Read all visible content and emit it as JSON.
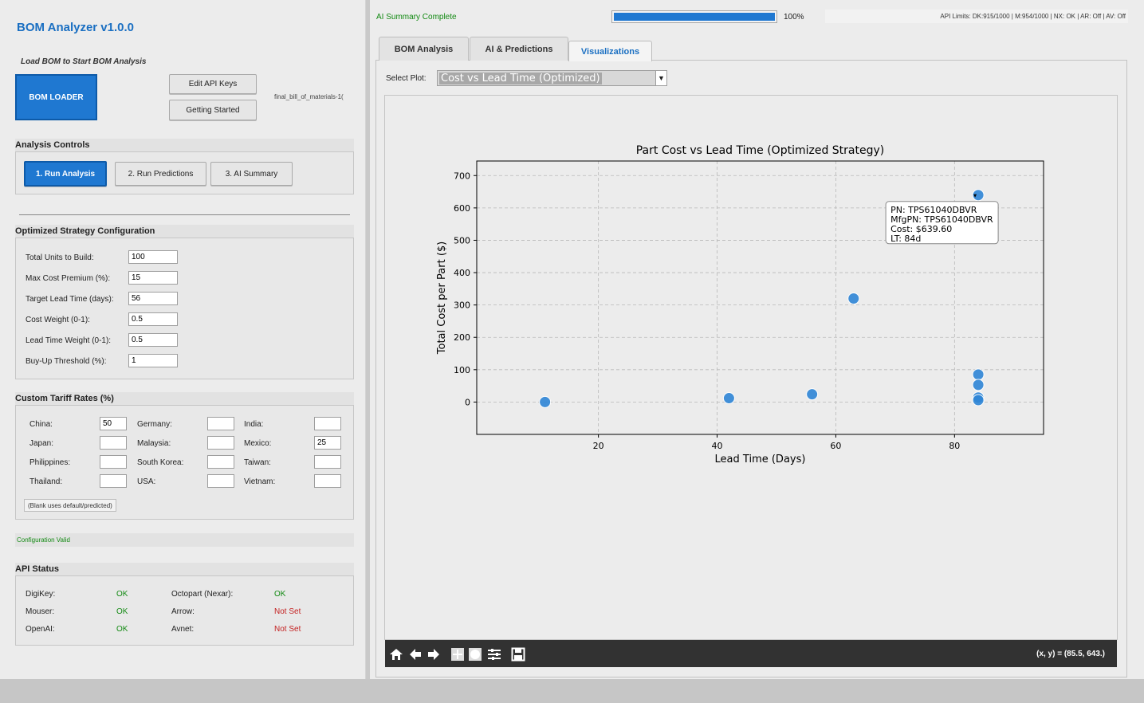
{
  "app": {
    "title": "BOM Analyzer v1.0.0",
    "load_hint": "Load BOM to Start BOM Analysis",
    "bom_loader_label": "BOM LOADER",
    "edit_api_keys_label": "Edit API Keys",
    "getting_started_label": "Getting Started",
    "loaded_file": "final_bill_of_materials-1("
  },
  "analysis_controls": {
    "title": "Analysis Controls",
    "buttons": [
      "1. Run Analysis",
      "2. Run Predictions",
      "3. AI Summary"
    ]
  },
  "strategy_config": {
    "title": "Optimized Strategy Configuration",
    "fields": [
      {
        "label": "Total Units to Build:",
        "value": "100"
      },
      {
        "label": "Max Cost Premium (%):",
        "value": "15"
      },
      {
        "label": "Target Lead Time (days):",
        "value": "56"
      },
      {
        "label": "Cost Weight (0-1):",
        "value": "0.5"
      },
      {
        "label": "Lead Time Weight (0-1):",
        "value": "0.5"
      },
      {
        "label": "Buy-Up Threshold (%):",
        "value": "1"
      }
    ]
  },
  "tariffs": {
    "title": "Custom Tariff Rates (%)",
    "countries": [
      {
        "label": "China:",
        "value": "50"
      },
      {
        "label": "Germany:",
        "value": ""
      },
      {
        "label": "India:",
        "value": ""
      },
      {
        "label": "Japan:",
        "value": ""
      },
      {
        "label": "Malaysia:",
        "value": ""
      },
      {
        "label": "Mexico:",
        "value": "25"
      },
      {
        "label": "Philippines:",
        "value": ""
      },
      {
        "label": "South Korea:",
        "value": ""
      },
      {
        "label": "Taiwan:",
        "value": ""
      },
      {
        "label": "Thailand:",
        "value": ""
      },
      {
        "label": "USA:",
        "value": ""
      },
      {
        "label": "Vietnam:",
        "value": ""
      }
    ],
    "note": "(Blank uses default/predicted)"
  },
  "config_status": "Configuration Valid",
  "api_status": {
    "title": "API Status",
    "items": [
      {
        "label": "DigiKey:",
        "status": "OK"
      },
      {
        "label": "Octopart (Nexar):",
        "status": "OK"
      },
      {
        "label": "Mouser:",
        "status": "OK"
      },
      {
        "label": "Arrow:",
        "status": "Not Set"
      },
      {
        "label": "OpenAI:",
        "status": "OK"
      },
      {
        "label": "Avnet:",
        "status": "Not Set"
      }
    ]
  },
  "top_status": {
    "message": "AI Summary Complete",
    "progress": 1.0,
    "progress_label": "100%",
    "api_limits": "API Limits: DK:915/1000 | M:954/1000 | NX: OK | AR: Off | AV: Off"
  },
  "tabs": [
    "BOM Analysis",
    "AI & Predictions",
    "Visualizations"
  ],
  "active_tab": "Visualizations",
  "select_plot": {
    "label": "Select Plot:",
    "value": "Cost vs Lead Time (Optimized)"
  },
  "chart_data": {
    "type": "scatter",
    "title": "Part Cost vs Lead Time (Optimized Strategy)",
    "xlabel": "Lead Time (Days)",
    "ylabel": "Total Cost per Part ($)",
    "xlim": [
      -0.5,
      95
    ],
    "ylim": [
      -100,
      745
    ],
    "xticks": [
      20,
      40,
      60,
      80
    ],
    "yticks": [
      0,
      100,
      200,
      300,
      400,
      500,
      600,
      700
    ],
    "grid": true,
    "point_color": "#2f86d6",
    "points": [
      {
        "x": 11,
        "y": 0
      },
      {
        "x": 42,
        "y": 12
      },
      {
        "x": 56,
        "y": 24
      },
      {
        "x": 63,
        "y": 320
      },
      {
        "x": 84,
        "y": 639.6
      },
      {
        "x": 84,
        "y": 85
      },
      {
        "x": 84,
        "y": 53
      },
      {
        "x": 84,
        "y": 14
      },
      {
        "x": 84,
        "y": 6
      }
    ],
    "tooltip": {
      "lines": [
        "PN: TPS61040DBVR",
        "MfgPN: TPS61040DBVR",
        "Cost: $639.60",
        "LT: 84d"
      ]
    }
  },
  "toolbar": {
    "icons": [
      "home-icon",
      "back-icon",
      "forward-icon",
      "pan-icon",
      "zoom-icon",
      "configure-icon",
      "save-icon"
    ],
    "coords": "(x, y) = (85.5, 643.)"
  }
}
